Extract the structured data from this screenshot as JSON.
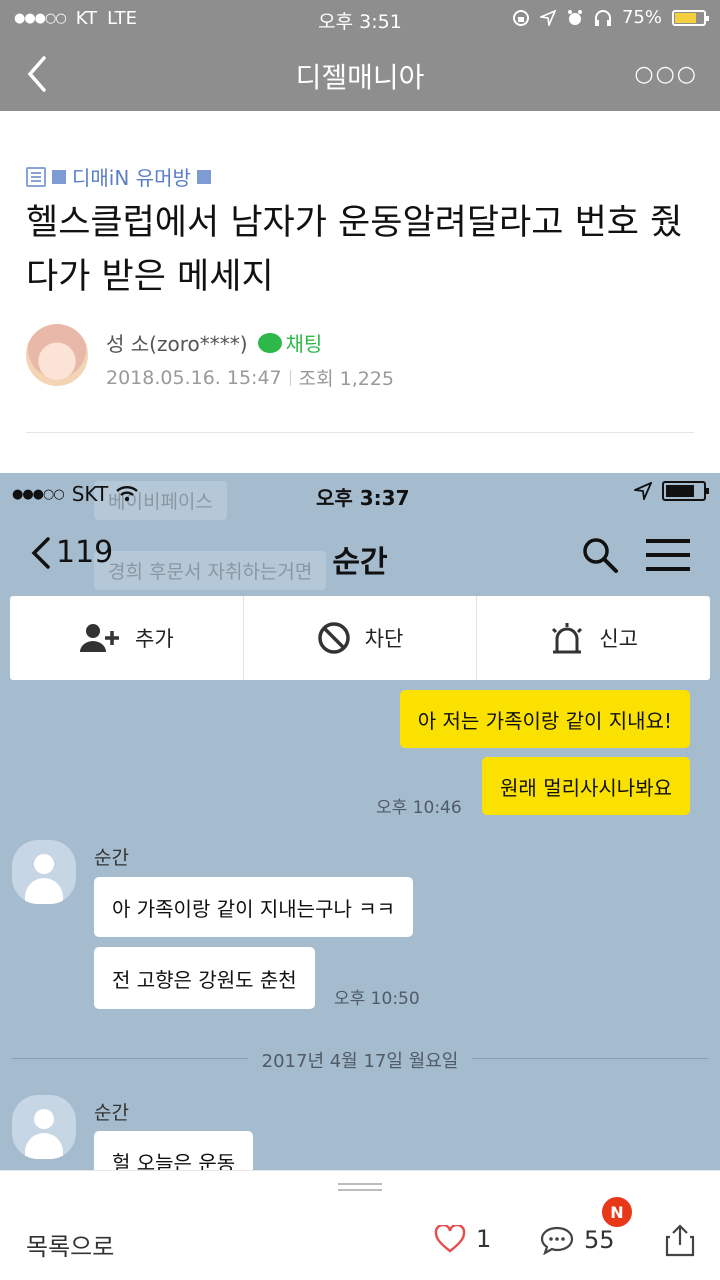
{
  "status_bar": {
    "carrier": "KT",
    "network": "LTE",
    "time": "오후 3:51",
    "battery": "75%",
    "battery_level": 0.75
  },
  "header": {
    "title": "디젤매니아"
  },
  "article": {
    "board": "디매iN 유머방",
    "title": "헬스클럽에서 남자가 운동알려달라고 번호 줬다가 받은 메세지",
    "author": "성 소(zoro****)",
    "chat_label": "채팅",
    "date": "2018.05.16. 15:47",
    "views": "조회 1,225"
  },
  "chat_screenshot": {
    "status_bar": {
      "carrier": "SKT",
      "time": "오후 3:37"
    },
    "ghost_texts": [
      "베이비페이스",
      "경희 후문서 자취하는거면"
    ],
    "nav": {
      "back_count": "119",
      "title": "순간"
    },
    "actions": [
      {
        "label": "추가",
        "icon": "add-friend-icon"
      },
      {
        "label": "차단",
        "icon": "block-icon"
      },
      {
        "label": "신고",
        "icon": "siren-icon"
      }
    ],
    "messages_me": [
      {
        "text": "아 저는 가족이랑 같이 지내요!"
      },
      {
        "text": "원래 멀리사시나봐요"
      }
    ],
    "time_me": "오후 10:46",
    "sender": "순간",
    "messages_them_1": [
      {
        "text": "아 가족이랑 같이 지내는구나 ㅋㅋ"
      },
      {
        "text": "전 고향은 강원도 춘천"
      }
    ],
    "time_them": "오후 10:50",
    "date_divider": "2017년 4월 17일 월요일",
    "sender_2": "순간",
    "partial_message": "헐 오늘은 운동"
  },
  "bottom_bar": {
    "list_label": "목록으로",
    "likes": "1",
    "comments": "55",
    "new_badge": "N",
    "colors": {
      "badge": "#e8381a",
      "heart": "#e84d4d"
    }
  }
}
